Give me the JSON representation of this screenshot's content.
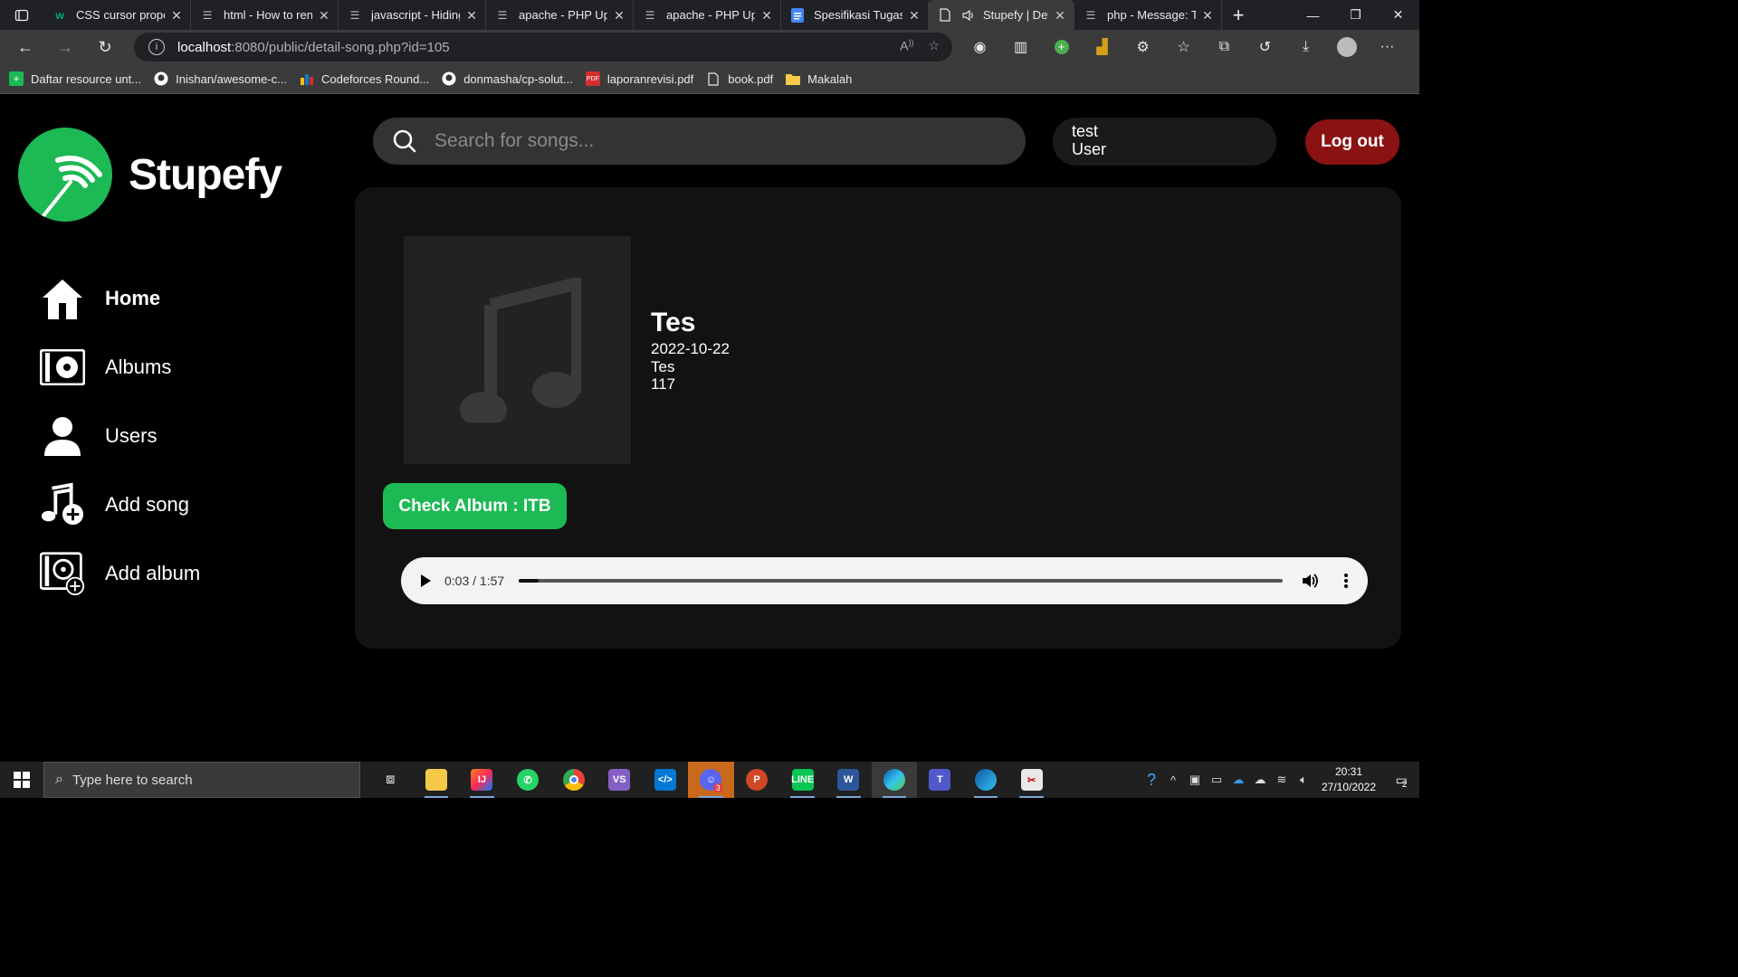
{
  "browser": {
    "tabs": [
      {
        "title": "CSS cursor proper",
        "icon": "w3schools-icon"
      },
      {
        "title": "html - How to ren",
        "icon": "stackoverflow-icon"
      },
      {
        "title": "javascript - Hiding",
        "icon": "stackoverflow-icon"
      },
      {
        "title": "apache - PHP Upl",
        "icon": "stackoverflow-icon"
      },
      {
        "title": "apache - PHP Upl",
        "icon": "stackoverflow-icon"
      },
      {
        "title": "Spesifikasi Tugas",
        "icon": "google-docs-icon"
      },
      {
        "title": "Stupefy | Det",
        "icon": "page-icon",
        "active": true,
        "audio": true
      },
      {
        "title": "php - Message: Tr",
        "icon": "stackoverflow-icon"
      }
    ],
    "address": {
      "host": "localhost",
      "rest": ":8080/public/detail-song.php?id=105"
    },
    "bookmarks": [
      {
        "label": "Daftar resource unt...",
        "icon": "plus-icon"
      },
      {
        "label": "Inishan/awesome-c...",
        "icon": "github-icon"
      },
      {
        "label": "Codeforces Round...",
        "icon": "codeforces-icon"
      },
      {
        "label": "donmasha/cp-solut...",
        "icon": "github-icon"
      },
      {
        "label": "laporanrevisi.pdf",
        "icon": "pdf-icon"
      },
      {
        "label": "book.pdf",
        "icon": "file-icon"
      },
      {
        "label": "Makalah",
        "icon": "folder-icon"
      }
    ]
  },
  "app": {
    "name": "Stupefy",
    "search_placeholder": "Search for songs...",
    "user": {
      "name": "test",
      "role": "User"
    },
    "logout_label": "Log out",
    "nav": [
      {
        "label": "Home",
        "icon": "home-icon",
        "active": true
      },
      {
        "label": "Albums",
        "icon": "album-icon"
      },
      {
        "label": "Users",
        "icon": "user-icon"
      },
      {
        "label": "Add song",
        "icon": "add-song-icon"
      },
      {
        "label": "Add album",
        "icon": "add-album-icon"
      }
    ]
  },
  "song": {
    "title": "Tes",
    "date": "2022-10-22",
    "genre": "Tes",
    "duration": "117",
    "album_button": "Check Album : ITB",
    "player": {
      "time": "0:03 / 1:57",
      "progress": 0.026
    }
  },
  "taskbar": {
    "search_placeholder": "Type here to search",
    "time": "20:31",
    "date": "27/10/2022",
    "notifications": "2",
    "apps": [
      "task-view-icon",
      "file-explorer-icon",
      "intellij-icon",
      "whatsapp-icon",
      "chrome-icon",
      "visual-studio-icon",
      "vscode-icon",
      "discord-icon",
      "powerpoint-icon",
      "line-icon",
      "word-icon",
      "edge-icon",
      "teams-icon",
      "edge-beta-icon",
      "snipping-tool-icon"
    ],
    "discord_badge": "3"
  },
  "colors": {
    "accent": "#1db954",
    "logout": "#8b1212",
    "card": "#121212"
  }
}
